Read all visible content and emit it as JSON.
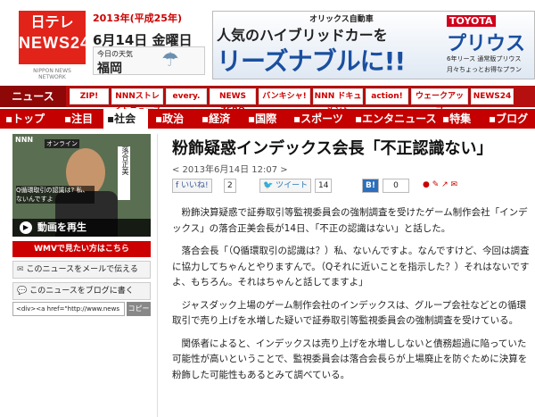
{
  "header": {
    "logo_line1": "日テレ",
    "logo_line2": "NEWS24",
    "logo_sub": "NIPPON NEWS NETWORK",
    "year": "2013年(平成25年)",
    "date": "6月14日 金曜日",
    "weather_label": "今日の天気",
    "weather_city": "福岡",
    "weather_icon": "cloud-rain-icon"
  },
  "ad": {
    "top": "オリックス自動車",
    "line1": "人気のハイブリッドカーを",
    "line2": "リーズナブルに!!",
    "brand": "TOYOTA",
    "product": "プリウス",
    "note": "6年リース 通常版プリウス",
    "fine": "月々ちょっとお得なプラン"
  },
  "nav": {
    "label": "ニュース",
    "channels": [
      "ZIP!",
      "NNNストレイトニュース",
      "every.",
      "NEWS ZERO",
      "バンキシャ!",
      "NNN ドキュメント",
      "action!",
      "ウェークアップ",
      "NEWS24"
    ],
    "categories": [
      "トップ",
      "注目",
      "社会",
      "政治",
      "経済",
      "国際",
      "スポーツ",
      "エンタニュース",
      "特集",
      "ブログ"
    ],
    "active": "社会"
  },
  "video": {
    "logo": "NNN",
    "overlay_title": "オンライン",
    "side_text": "落合正美",
    "caption": "Q循環取引の認識は? 私、ないんですよ",
    "play_label": "動画を再生",
    "wmv_label": "WMVで見たい方はこちら"
  },
  "share": {
    "mail": "このニュースをメールで伝える",
    "blog": "このニュースをブログに書く",
    "code": "<div><a href=\"http://www.news",
    "copy": "コピー"
  },
  "article": {
    "title": "粉飾疑惑インデックス会長「不正認識ない」",
    "datetime": "< 2013年6月14日 12:07 >",
    "like_label": "いいね!",
    "like_count": "2",
    "tweet_label": "ツイート",
    "tweet_count": "14",
    "hatena_count": "0",
    "paragraphs": [
      "粉飾決算疑惑で証券取引等監視委員会の強制調査を受けたゲーム制作会社「インデックス」の落合正美会長が14日、「不正の認識はない」と話した。",
      "落合会長「（Q循環取引の認識は？）私、ないんですよ。なんですけど、今回は調査に協力してちゃんとやりますんで。（Qそれに近いことを指示した？）それはないですよ、もちろん。それはちゃんと話してますよ」",
      "ジャスダック上場のゲーム制作会社のインデックスは、グループ会社などとの循環取引で売り上げを水増した疑いで証券取引等監視委員会の強制調査を受けている。",
      "関係者によると、インデックスは売り上げを水増ししないと債務超過に陥っていた可能性が高いということで、監視委員会は落合会長らが上場廃止を防ぐために決算を粉飾した可能性もあるとみて調べている。"
    ]
  },
  "colors": {
    "brand_red": "#c40000",
    "nav_dark": "#8e0808"
  }
}
